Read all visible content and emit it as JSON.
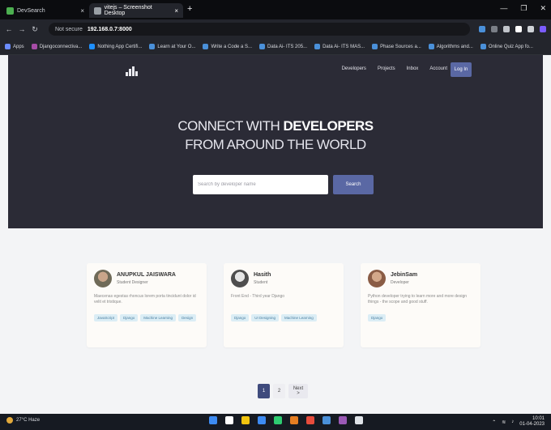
{
  "browser": {
    "tabs": [
      {
        "title": "DevSearch",
        "favicon_color": "#4caf50"
      },
      {
        "title": "vitejs – Screenshot Desktop",
        "favicon_color": "#9aa0a6"
      }
    ],
    "new_tab": "+",
    "url": {
      "security": "Not secure",
      "address": "192.168.0.7:8000"
    },
    "bookmarks": [
      {
        "label": "Apps",
        "color": "#6b8cff"
      },
      {
        "label": "Djangoconnectiva...",
        "color": "#a64ca6"
      },
      {
        "label": "Nothing App Certifi...",
        "color": "#1e90ff"
      },
      {
        "label": "Learn at Your O...",
        "color": "#4a90d9"
      },
      {
        "label": "Write a Code a S...",
        "color": "#4a90d9"
      },
      {
        "label": "Data Ai- ITS 205...",
        "color": "#4a90d9"
      },
      {
        "label": "Data Ai- ITS MAS...",
        "color": "#4a90d9"
      },
      {
        "label": "Phase Sources a...",
        "color": "#4a90d9"
      },
      {
        "label": "Algorithms and...",
        "color": "#4a90d9"
      },
      {
        "label": "Online Quiz App fo...",
        "color": "#4a90d9"
      }
    ],
    "extension_colors": [
      "#4a90d9",
      "#7a7f87",
      "#c0c4ca",
      "#ffffff",
      "#cfd3d8",
      "#7b5cff"
    ]
  },
  "site": {
    "nav": [
      "Developers",
      "Projects",
      "Inbox",
      "Account"
    ],
    "login": "Log In",
    "hero_line1_prefix": "CONNECT WITH ",
    "hero_line1_bold": "DEVELOPERS",
    "hero_line2": "FROM AROUND THE WORLD",
    "search_placeholder": "Search by developer name",
    "search_button": "Search"
  },
  "developers": [
    {
      "name": "ANUPKUL JAISWARA",
      "headline": "Student Designer",
      "bio": "Maecenas egestas rhoncus lorem porta tincidunt dolor id velit et tristique.",
      "tags": [
        "JavaScript",
        "Django",
        "Machine Learning",
        "Design"
      ]
    },
    {
      "name": "Hasith",
      "headline": "Student",
      "bio": "Front End - Third year Django",
      "tags": [
        "Django",
        "UI Designing",
        "Machine Learning"
      ]
    },
    {
      "name": "JebinSam",
      "headline": "Developer",
      "bio": "Python developer trying to learn more and more design things - the scope and good stuff.",
      "tags": [
        "Django"
      ]
    }
  ],
  "pagination": {
    "pages": [
      "1",
      "2"
    ],
    "next": "Next >"
  },
  "taskbar": {
    "weather": "27°C Haze",
    "app_colors": [
      "#3d8bf2",
      "#ffffff",
      "#f1c40f",
      "#3d8bf2",
      "#2ecc71",
      "#e67e22",
      "#e74c3c",
      "#4a90d9",
      "#9b59b6",
      "#dfe3e8"
    ],
    "time": "10:01",
    "date": "01-04-2023"
  }
}
